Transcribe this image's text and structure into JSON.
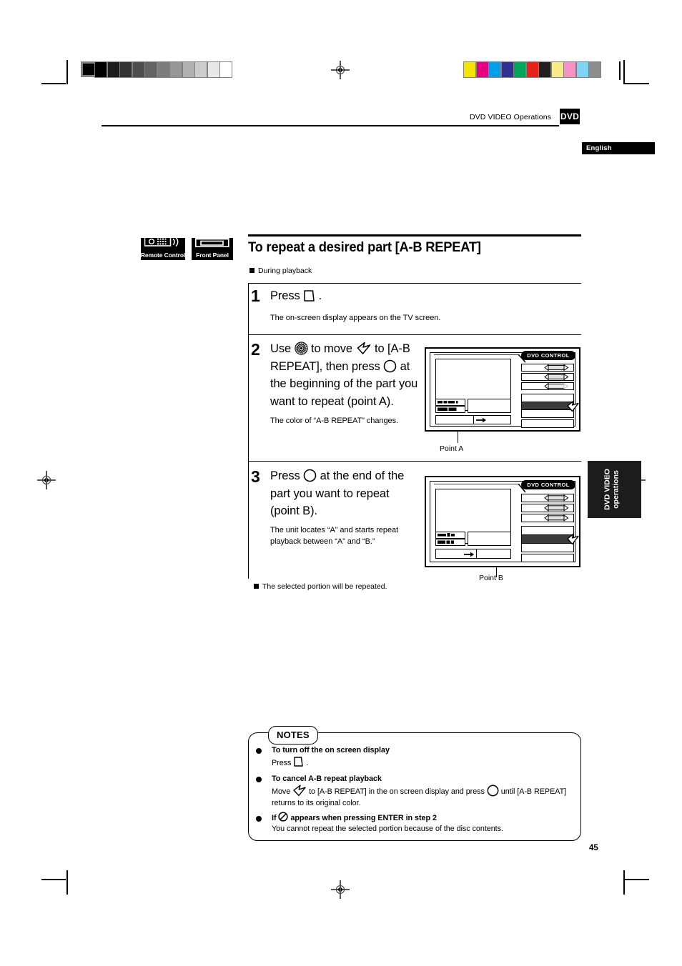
{
  "document": {
    "page_number": "45",
    "language_tab": "English",
    "running_head": "DVD VIDEO Operations",
    "media_tab": "DVD",
    "side_tab_line1": "DVD VIDEO",
    "side_tab_line2": "operations"
  },
  "badges": [
    {
      "label": "Remote Control",
      "icon": "remote-control-icon"
    },
    {
      "label": "Front Panel",
      "icon": "front-panel-icon"
    }
  ],
  "section": {
    "heading": "To repeat a desired part [A-B REPEAT]",
    "condition": "During playback"
  },
  "steps": [
    {
      "number": "1",
      "text_before_icon": "Press",
      "icon": "osd-button-icon",
      "text_after_icon": ".",
      "description": "The on-screen display appears on the TV screen."
    },
    {
      "number": "2",
      "line1_a": "Use",
      "icon1": "joystick-icon",
      "line1_b": "to move",
      "icon2": "cursor-arrow-icon",
      "line1_c": "to [A-B",
      "line2_a": "REPEAT], then press",
      "icon3": "enter-button-icon",
      "line2_b": "at",
      "line3": "the beginning of the part you",
      "line4": "want to repeat (point A).",
      "description": "The color of “A-B REPEAT” changes.",
      "screen_caption": "Point A"
    },
    {
      "number": "3",
      "line1_a": "Press",
      "icon1": "enter-button-icon",
      "line1_b": "at the end of the",
      "line2": "part you want to repeat",
      "line3": "(point B).",
      "description": "The unit locates “A” and starts repeat playback between “A” and “B.”",
      "screen_caption": "Point B"
    }
  ],
  "closing_bullet": "The selected portion will be repeated.",
  "screens": {
    "title_badge": "DVD CONTROL"
  },
  "notes": {
    "tag": "NOTES",
    "items": [
      {
        "title": "To turn off the on screen display",
        "body_a": "Press",
        "icon": "osd-button-icon",
        "body_b": "."
      },
      {
        "title": "To cancel A-B repeat playback",
        "body_a": "Move",
        "icon1": "cursor-arrow-icon",
        "body_b": "to [A-B REPEAT] in the on screen display and press",
        "icon2": "enter-button-icon",
        "body_c": "until",
        "body_d": "[A-B REPEAT] returns to its original color."
      },
      {
        "title_a": "If",
        "icon": "prohibited-icon",
        "title_b": "appears when pressing ENTER in step 2",
        "body": "You cannot repeat the selected portion because of the disc contents."
      }
    ]
  },
  "calibration": {
    "grayscale": [
      "#000000",
      "#1c1c1c",
      "#333333",
      "#4d4d4d",
      "#636363",
      "#7d7d7d",
      "#969696",
      "#b0b0b0",
      "#cccccc",
      "#e8e8e8",
      "#ffffff"
    ],
    "colors": [
      "#f5e400",
      "#e4007f",
      "#00a0e9",
      "#2e3192",
      "#00a65a",
      "#e7211a",
      "#231f20",
      "#faeb8a",
      "#f493c4",
      "#7fd4f4",
      "#8d8d8d"
    ]
  }
}
